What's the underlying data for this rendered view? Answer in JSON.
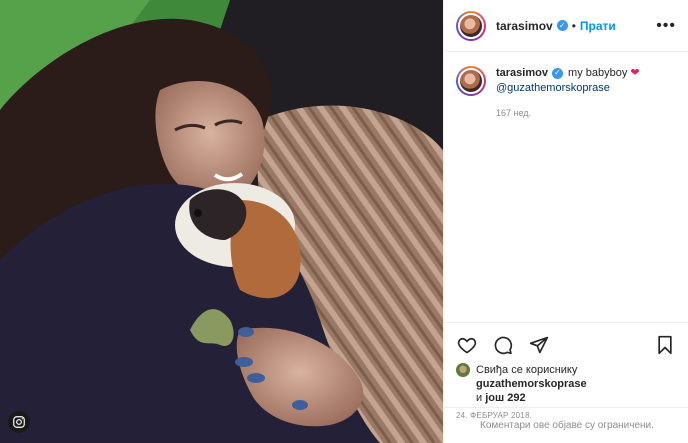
{
  "post": {
    "author": {
      "username": "tarasimov",
      "verified": true,
      "follow_label": "Прати",
      "separator": "•"
    },
    "more_label": "•••",
    "caption": {
      "username": "tarasimov",
      "text": "my babyboy",
      "emoji": "❤",
      "mention": "@guzathemorskoprase",
      "time_ago": "167 нед."
    },
    "likes": {
      "prefix": "Свиђа се кориснику",
      "user": "guzathemorskoprase",
      "middle": "и",
      "more_prefix": "још",
      "count": "292"
    },
    "date": "24. ФЕБРУАР 2018.",
    "comments_limited": "Коментари ове објаве су ограничени.",
    "icons": [
      "heart-icon",
      "comment-icon",
      "share-icon",
      "bookmark-icon",
      "instagram-icon",
      "verified-icon"
    ],
    "colors": {
      "link_blue": "#0095f6",
      "verified_blue": "#3897f0",
      "mention_navy": "#00376b",
      "muted_gray": "#8e8e8e",
      "heart_red": "#e0245e"
    }
  }
}
